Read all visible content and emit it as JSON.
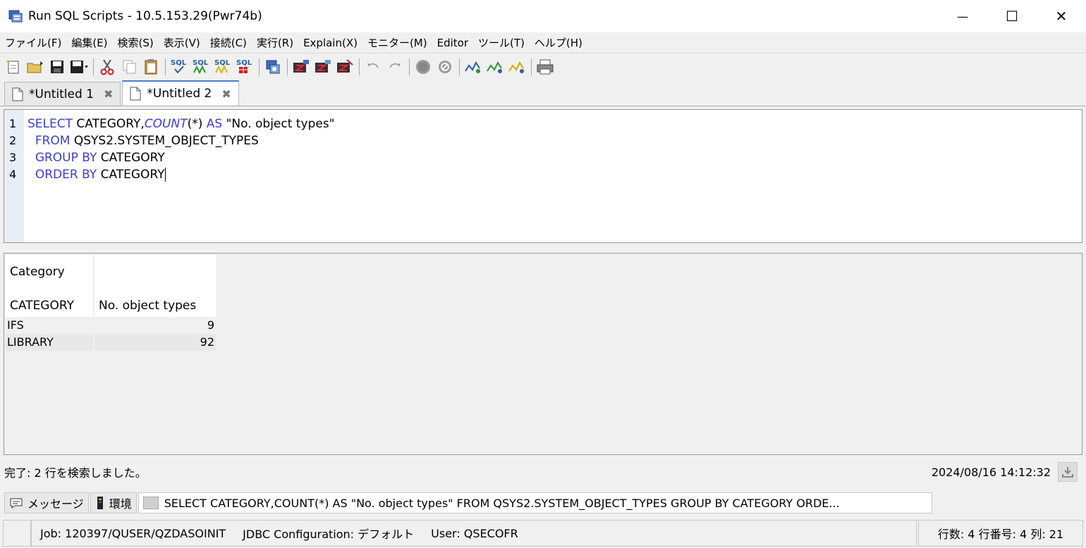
{
  "window": {
    "title": "Run SQL Scripts - 10.5.153.29(Pwr74b)",
    "minimize_glyph": "—",
    "maximize_glyph": "☐",
    "close_glyph": "✕"
  },
  "menu": [
    "ファイル(F)",
    "編集(E)",
    "検索(S)",
    "表示(V)",
    "接続(C)",
    "実行(R)",
    "Explain(X)",
    "モニター(M)",
    "Editor",
    "ツール(T)",
    "ヘルプ(H)"
  ],
  "toolbar": {
    "icons": [
      "new-file-icon",
      "open-folder-icon",
      "save-icon",
      "save-as-icon",
      "cut-icon",
      "copy-icon",
      "paste-icon",
      "run-sql-check-icon",
      "run-all-icon",
      "run-from-icon",
      "run-selected-icon",
      "connection-icon",
      "explain-icon",
      "visual-explain-icon",
      "explain-clear-icon",
      "undo-icon",
      "redo-icon",
      "stop-icon",
      "cancel-icon",
      "monitor-icon",
      "monitor-start-icon",
      "monitor-stop-icon",
      "print-icon"
    ],
    "sql_label": "SQL"
  },
  "tabs": [
    {
      "label": "*Untitled 1",
      "active": false
    },
    {
      "label": "*Untitled 2",
      "active": true
    }
  ],
  "tab_close_glyph": "✖",
  "editor": {
    "line_numbers": [
      "1",
      "2",
      "3",
      "4"
    ],
    "line1": {
      "kw1": "SELECT",
      "t1": " CATEGORY,",
      "fn": "COUNT",
      "t2": "(*) ",
      "kw2": "AS",
      "t3": " \"No. object types\""
    },
    "line2": {
      "indent": "  ",
      "kw": "FROM",
      "t": " QSYS2.SYSTEM_OBJECT_TYPES"
    },
    "line3": {
      "indent": "  ",
      "kw": "GROUP BY",
      "t": " CATEGORY"
    },
    "line4": {
      "indent": "  ",
      "kw": "ORDER BY",
      "t": " CATEGORY"
    }
  },
  "results": {
    "header": [
      {
        "top": "Category",
        "bottom": "CATEGORY"
      },
      {
        "top": "",
        "bottom": "No. object types"
      }
    ],
    "rows": [
      [
        "IFS",
        "9"
      ],
      [
        "LIBRARY",
        "92"
      ]
    ]
  },
  "status": {
    "message": "完了: 2 行を検索しました。",
    "timestamp": "2024/08/16 14:12:32"
  },
  "bottom_tabs": {
    "messages": "メッセージ",
    "environment": "環境",
    "sql": "SELECT CATEGORY,COUNT(*) AS \"No. object types\" FROM QSYS2.SYSTEM_OBJECT_TYPES GROUP BY CATEGORY ORDE..."
  },
  "statusbar": {
    "job": "Job: 120397/QUSER/QZDASOINIT",
    "jdbc": "JDBC Configuration: デフォルト",
    "user": "User: QSECOFR",
    "position": "行数: 4  行番号: 4  列: 21"
  }
}
